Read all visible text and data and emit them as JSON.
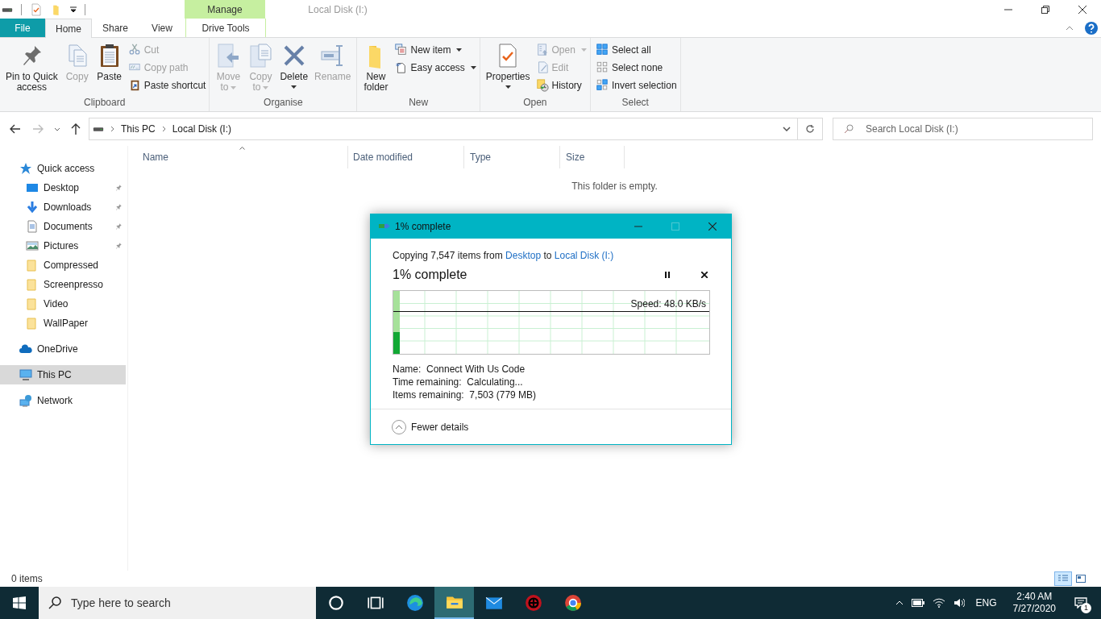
{
  "window": {
    "title": "Local Disk (I:)",
    "context_tab": "Manage"
  },
  "ribbon_tabs": [
    {
      "label": "File",
      "kind": "file",
      "selected": false
    },
    {
      "label": "Home",
      "kind": "tab",
      "selected": true
    },
    {
      "label": "Share",
      "kind": "tab",
      "selected": false
    },
    {
      "label": "View",
      "kind": "tab",
      "selected": false
    },
    {
      "label": "Drive Tools",
      "kind": "context",
      "selected": false
    }
  ],
  "ribbon": {
    "groups": [
      {
        "label": "Clipboard",
        "items": [
          {
            "kind": "large",
            "label": "Pin to Quick\naccess",
            "disabled": false,
            "dropdown": false
          },
          {
            "kind": "large",
            "label": "Copy",
            "disabled": true,
            "dropdown": false
          },
          {
            "kind": "large",
            "label": "Paste",
            "disabled": false,
            "dropdown": false
          },
          {
            "kind": "small",
            "label": "Cut",
            "disabled": true,
            "dropdown": false
          },
          {
            "kind": "small",
            "label": "Copy path",
            "disabled": true,
            "dropdown": false
          },
          {
            "kind": "small",
            "label": "Paste shortcut",
            "disabled": false,
            "dropdown": false
          }
        ]
      },
      {
        "label": "Organise",
        "items": [
          {
            "kind": "large",
            "label": "Move\nto",
            "disabled": true,
            "dropdown": true
          },
          {
            "kind": "large",
            "label": "Copy\nto",
            "disabled": true,
            "dropdown": true
          },
          {
            "kind": "large",
            "label": "Delete",
            "disabled": false,
            "dropdown": true
          },
          {
            "kind": "large",
            "label": "Rename",
            "disabled": true,
            "dropdown": false
          }
        ]
      },
      {
        "label": "New",
        "items": [
          {
            "kind": "large",
            "label": "New\nfolder",
            "disabled": false,
            "dropdown": false
          },
          {
            "kind": "small",
            "label": "New item",
            "disabled": false,
            "dropdown": true
          },
          {
            "kind": "small",
            "label": "Easy access",
            "disabled": false,
            "dropdown": true
          }
        ]
      },
      {
        "label": "Open",
        "items": [
          {
            "kind": "large",
            "label": "Properties",
            "disabled": false,
            "dropdown": true
          },
          {
            "kind": "small",
            "label": "Open",
            "disabled": true,
            "dropdown": true
          },
          {
            "kind": "small",
            "label": "Edit",
            "disabled": true,
            "dropdown": false
          },
          {
            "kind": "small",
            "label": "History",
            "disabled": false,
            "dropdown": false
          }
        ]
      },
      {
        "label": "Select",
        "items": [
          {
            "kind": "small",
            "label": "Select all",
            "disabled": false,
            "dropdown": false
          },
          {
            "kind": "small",
            "label": "Select none",
            "disabled": false,
            "dropdown": false
          },
          {
            "kind": "small",
            "label": "Invert selection",
            "disabled": false,
            "dropdown": false
          }
        ]
      }
    ]
  },
  "address": {
    "crumbs": [
      "This PC",
      "Local Disk (I:)"
    ]
  },
  "search": {
    "placeholder": "Search Local Disk (I:)"
  },
  "navigation": [
    {
      "label": "Quick access",
      "selected": false,
      "children": [
        {
          "label": "Desktop",
          "pinned": true,
          "selected": false
        },
        {
          "label": "Downloads",
          "pinned": true,
          "selected": false
        },
        {
          "label": "Documents",
          "pinned": true,
          "selected": false
        },
        {
          "label": "Pictures",
          "pinned": true,
          "selected": false
        },
        {
          "label": "Compressed",
          "pinned": false,
          "selected": false
        },
        {
          "label": "Screenpresso",
          "pinned": false,
          "selected": false
        },
        {
          "label": "Video",
          "pinned": false,
          "selected": false
        },
        {
          "label": "WallPaper",
          "pinned": false,
          "selected": false
        }
      ]
    },
    {
      "label": "OneDrive",
      "selected": false
    },
    {
      "label": "This PC",
      "selected": true
    },
    {
      "label": "Network",
      "selected": false
    }
  ],
  "file_list": {
    "columns": [
      {
        "label": "Name",
        "sorted": true
      },
      {
        "label": "Date modified",
        "sorted": false
      },
      {
        "label": "Type",
        "sorted": false
      },
      {
        "label": "Size",
        "sorted": false
      }
    ],
    "empty_message": "This folder is empty."
  },
  "status_bar": {
    "item_count": "0 items"
  },
  "copy_dialog": {
    "title": "1% complete",
    "summary": {
      "prefix": "Copying 7,547 items from ",
      "source": "Desktop",
      "joiner": " to ",
      "destination": "Local Disk (I:)"
    },
    "progress_text": "1% complete",
    "level": 0.02,
    "speed": "Speed: 48.0 KB/s",
    "details": [
      "Name:  Connect With Us Code",
      "Time remaining:  Calculating...",
      "Items remaining:  7,503 (779 MB)"
    ],
    "toggle": {
      "label": "Fewer details",
      "expanded": true
    }
  },
  "taskbar": {
    "search_placeholder": "Type here to search",
    "apps": [
      {
        "active": false
      },
      {
        "active": false
      },
      {
        "active": false
      },
      {
        "active": true
      },
      {
        "active": false
      },
      {
        "active": false
      },
      {
        "active": false
      }
    ],
    "language": "ENG",
    "time": "2:40 AM",
    "date": "7/27/2020",
    "notification_count": "1"
  }
}
